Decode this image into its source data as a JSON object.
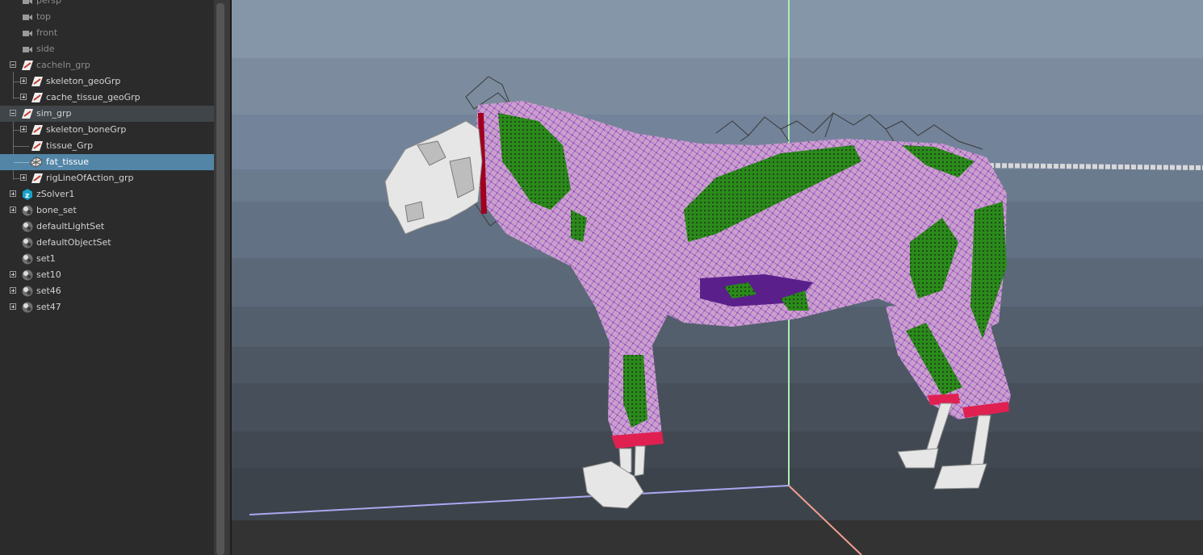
{
  "outliner": {
    "items": [
      {
        "label": "persp",
        "icon": "camera-icon"
      },
      {
        "label": "top",
        "icon": "camera-icon"
      },
      {
        "label": "front",
        "icon": "camera-icon"
      },
      {
        "label": "side",
        "icon": "camera-icon"
      },
      {
        "label": "cacheIn_grp",
        "icon": "group-icon"
      },
      {
        "label": "skeleton_geoGrp",
        "icon": "group-icon"
      },
      {
        "label": "cache_tissue_geoGrp",
        "icon": "group-icon"
      },
      {
        "label": "sim_grp",
        "icon": "group-icon"
      },
      {
        "label": "skeleton_boneGrp",
        "icon": "group-icon"
      },
      {
        "label": "tissue_Grp",
        "icon": "group-icon"
      },
      {
        "label": "fat_tissue",
        "icon": "mesh-icon",
        "selected": true
      },
      {
        "label": "rigLineOfAction_grp",
        "icon": "group-icon"
      },
      {
        "label": "zSolver1",
        "icon": "zsolver-icon"
      },
      {
        "label": "bone_set",
        "icon": "set-icon"
      },
      {
        "label": "defaultLightSet",
        "icon": "set-icon"
      },
      {
        "label": "defaultObjectSet",
        "icon": "set-icon"
      },
      {
        "label": "set1",
        "icon": "set-icon"
      },
      {
        "label": "set10",
        "icon": "set-icon"
      },
      {
        "label": "set46",
        "icon": "set-icon"
      },
      {
        "label": "set47",
        "icon": "set-icon"
      }
    ]
  },
  "viewport": {
    "grid_colors": {
      "x_axis": "#f0a090",
      "y_axis": "#a8f0b0",
      "z_axis": "#a8a8f0"
    },
    "colors": {
      "bg_top": "#8596a8",
      "bg_bottom": "#3d4650",
      "floor": "#333333",
      "tissue": "#c68fc9",
      "tissue_wire": "#a050e0",
      "fat_attach": "#2a8a1a",
      "fixed_rings": "#e02050",
      "bone": "#e8e8e8",
      "cage": "#404040"
    }
  }
}
